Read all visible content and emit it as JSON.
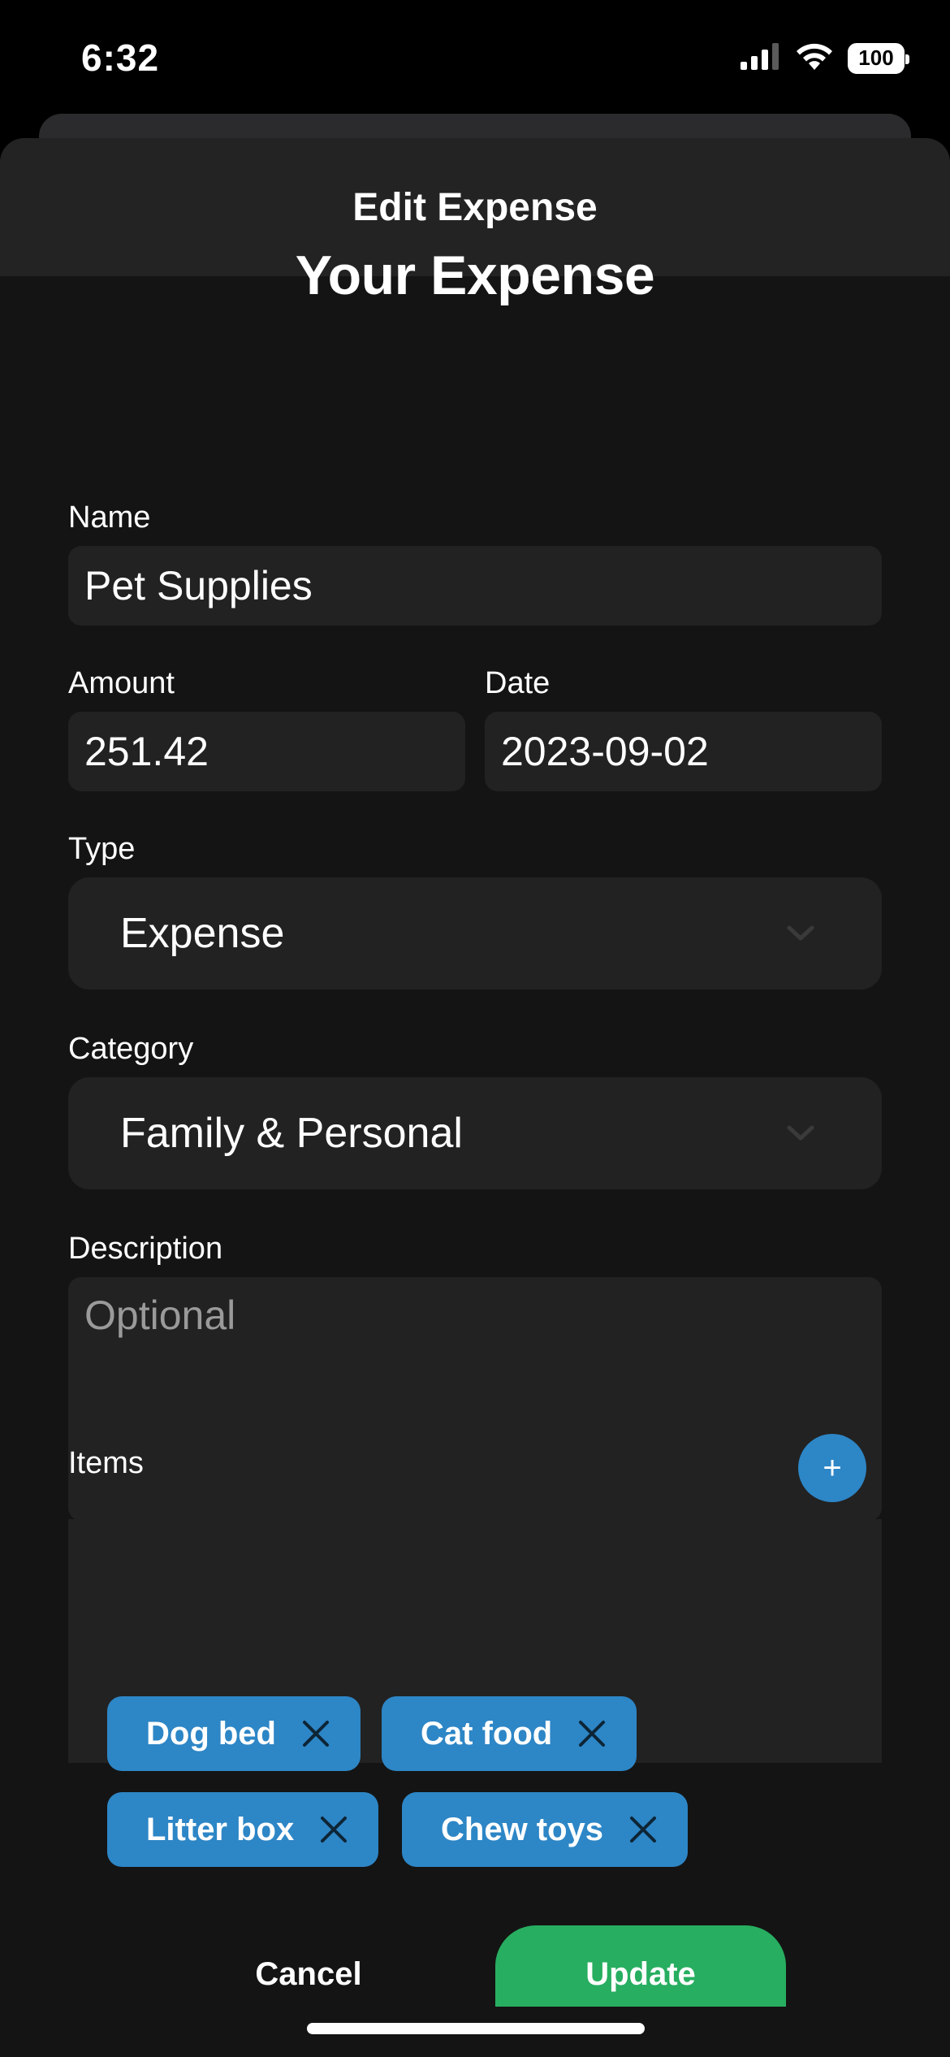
{
  "status_bar": {
    "time": "6:32",
    "battery": "100",
    "signal_icon": "cellular-signal-icon",
    "wifi_icon": "wifi-icon"
  },
  "sheet": {
    "title": "Edit Expense"
  },
  "form": {
    "heading": "Your Expense",
    "name_label": "Name",
    "name_value": "Pet Supplies",
    "amount_label": "Amount",
    "amount_value": "251.42",
    "date_label": "Date",
    "date_value": "2023-09-02",
    "type_label": "Type",
    "type_value": "Expense",
    "category_label": "Category",
    "category_value": "Family & Personal",
    "description_label": "Description",
    "description_placeholder": "Optional",
    "description_value": ""
  },
  "items": {
    "label": "Items",
    "add_label": "+",
    "chips": [
      "Dog bed",
      "Cat food",
      "Litter box",
      "Chew toys"
    ]
  },
  "actions": {
    "cancel": "Cancel",
    "update": "Update"
  },
  "colors": {
    "background": "#141414",
    "header": "#232323",
    "field": "#222222",
    "accent_blue": "#2d86c6",
    "accent_green": "#27ae60"
  }
}
